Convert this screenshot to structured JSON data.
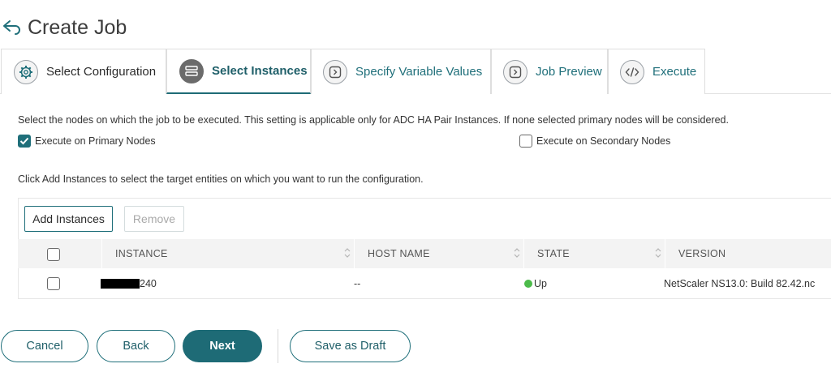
{
  "header": {
    "title": "Create Job",
    "back_icon": "back-arrow-icon"
  },
  "tabs": [
    {
      "label": "Select Configuration",
      "icon": "gear-icon",
      "active": false
    },
    {
      "label": "Select Instances",
      "icon": "instances-icon",
      "active": true
    },
    {
      "label": "Specify Variable Values",
      "icon": "chevron-right-icon",
      "active": false
    },
    {
      "label": "Job Preview",
      "icon": "chevron-right-icon",
      "active": false
    },
    {
      "label": "Execute",
      "icon": "code-icon",
      "active": false
    }
  ],
  "nodes": {
    "description": "Select the nodes on which the job to be executed. This setting is applicable only for ADC HA Pair Instances. If none selected primary nodes will be considered.",
    "primary": {
      "label": "Execute on Primary Nodes",
      "checked": true
    },
    "secondary": {
      "label": "Execute on Secondary Nodes",
      "checked": false
    }
  },
  "instances": {
    "description": "Click Add Instances to select the target entities on which you want to run the configuration.",
    "add_label": "Add Instances",
    "remove_label": "Remove",
    "columns": [
      "INSTANCE",
      "HOST NAME",
      "STATE",
      "VERSION"
    ],
    "rows": [
      {
        "instance_suffix": "240",
        "host_name": "--",
        "state": "Up",
        "version": "NetScaler NS13.0: Build 82.42.nc"
      }
    ]
  },
  "footer": {
    "cancel_label": "Cancel",
    "back_label": "Back",
    "next_label": "Next",
    "draft_label": "Save as Draft"
  },
  "colors": {
    "accent": "#1e6b76",
    "state_up": "#4cbb4a"
  }
}
